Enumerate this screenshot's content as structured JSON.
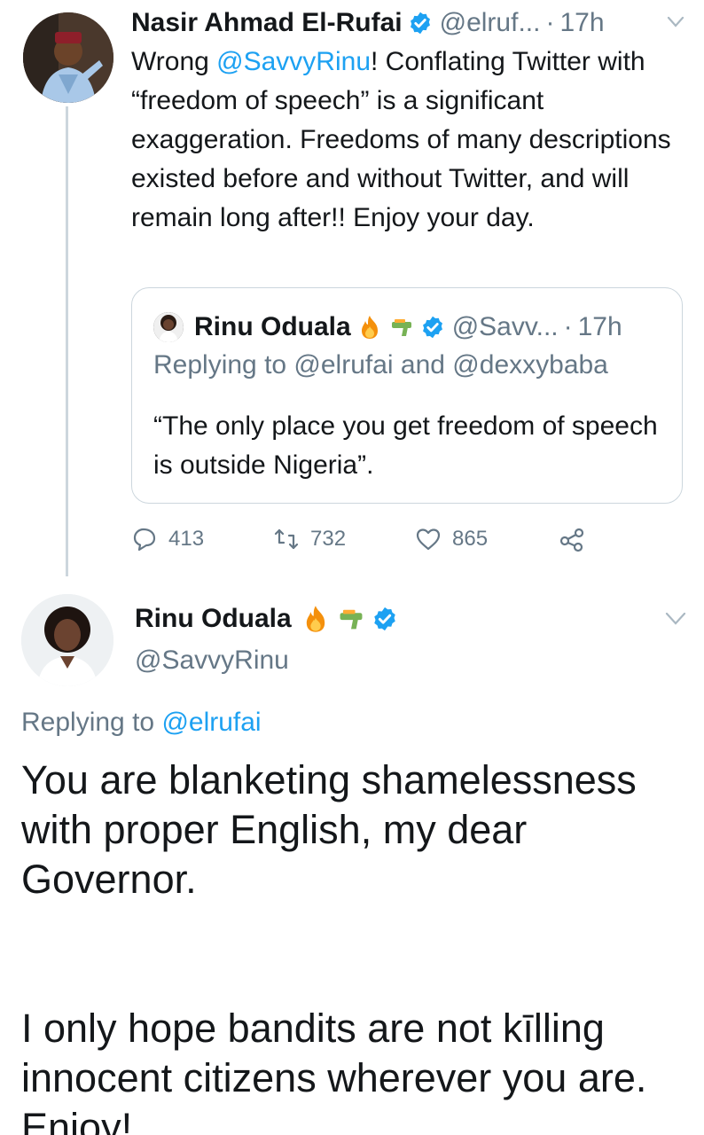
{
  "tweet1": {
    "name": "Nasir Ahmad El-Rufai",
    "handle": "@elruf...",
    "separator": "·",
    "time": "17h",
    "body_start": "Wrong ",
    "mention": "@SavvyRinu",
    "body_rest": "! Conflating Twitter with “freedom of speech” is a significant exaggeration. Freedoms of many descriptions existed before and without Twitter, and will remain long after!! Enjoy your day."
  },
  "quoted": {
    "name": "Rinu Oduala",
    "handle": "@Savv...",
    "separator": "·",
    "time": "17h",
    "replying_to": "Replying to @elrufai and @dexxybaba",
    "text": "“The only place you get freedom of speech is outside Nigeria”."
  },
  "actions": {
    "replies": "413",
    "retweets": "732",
    "likes": "865"
  },
  "tweet2": {
    "name": "Rinu Oduala",
    "handle": "@SavvyRinu",
    "replying_label": "Replying to ",
    "replying_mention": "@elrufai",
    "para1": "You are blanketing shamelessness with proper English, my dear Governor.",
    "para2": "I only hope bandits are not kīlling innocent citizens wherever you are. Enjoy!"
  },
  "colors": {
    "accent": "#1da1f2",
    "muted": "#657786",
    "text": "#14171a",
    "border": "#ccd6dd"
  },
  "icons": [
    "verified-badge-icon",
    "chevron-down-icon",
    "fire-emoji-icon",
    "water-pistol-emoji-icon",
    "reply-icon",
    "retweet-icon",
    "like-icon",
    "share-icon"
  ]
}
